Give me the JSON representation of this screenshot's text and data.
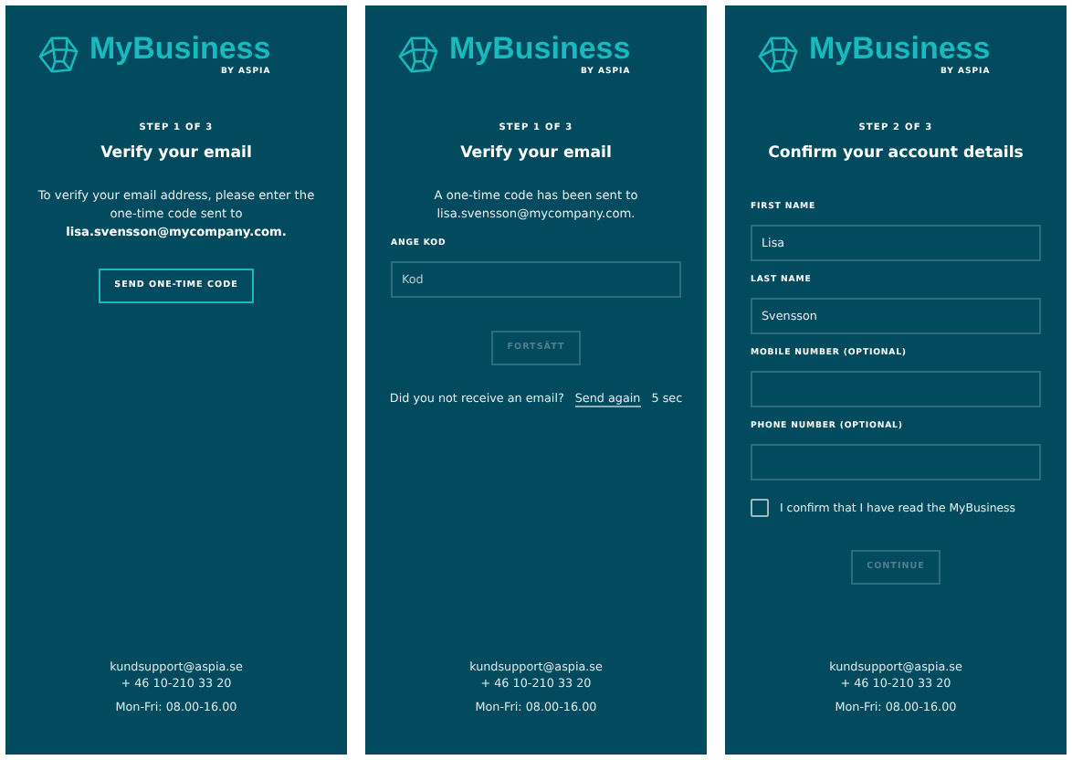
{
  "screens": [
    {
      "logo": {
        "name": "MyBusiness",
        "byline": "BY ASPIA"
      },
      "step": "STEP 1 OF 3",
      "title": "Verify your email",
      "items": [
        {
          "kind": "paragraph",
          "text": "To verify your email address, please enter the one-time code sent to **lisa.svensson@mycompany.com.**"
        },
        {
          "kind": "button",
          "label": "SEND ONE-TIME CODE",
          "disabled": false
        }
      ],
      "footer": {
        "email": "kundsupport@aspia.se",
        "phone": "+ 46 10-210 33 20",
        "hours": "Mon-Fri: 08.00-16.00"
      }
    },
    {
      "logo": {
        "name": "MyBusiness",
        "byline": "BY ASPIA"
      },
      "step": "STEP 1 OF 3",
      "title": "Verify your email",
      "items": [
        {
          "kind": "paragraph",
          "text": "A one-time code has been sent to lisa.svensson@mycompany.com."
        },
        {
          "kind": "field",
          "label": "ANGE KOD",
          "placeholder": "Kod"
        },
        {
          "kind": "button",
          "label": "FORTSÄTT",
          "disabled": true
        },
        {
          "kind": "resend",
          "text": "Did you not receive an email?",
          "link": "Send again",
          "countdown": "5 sec"
        }
      ],
      "footer": {
        "email": "kundsupport@aspia.se",
        "phone": "+ 46 10-210 33 20",
        "hours": "Mon-Fri: 08.00-16.00"
      }
    },
    {
      "logo": {
        "name": "MyBusiness",
        "byline": "BY ASPIA"
      },
      "step": "STEP 2 OF 3",
      "title": "Confirm your account details",
      "items": [
        {
          "kind": "field",
          "label": "FIRST NAME",
          "value": "Lisa"
        },
        {
          "kind": "field",
          "label": "LAST NAME",
          "value": "Svensson"
        },
        {
          "kind": "field",
          "label": "MOBILE NUMBER (OPTIONAL)"
        },
        {
          "kind": "field",
          "label": "PHONE NUMBER (OPTIONAL)"
        },
        {
          "kind": "checkbox",
          "label": "I confirm that I have read the MyBusiness",
          "checked": false
        },
        {
          "kind": "button",
          "label": "CONTINUE",
          "disabled": true
        }
      ],
      "footer": {
        "email": "kundsupport@aspia.se",
        "phone": "+ 46 10-210 33 20",
        "hours": "Mon-Fri: 08.00-16.00"
      }
    }
  ]
}
